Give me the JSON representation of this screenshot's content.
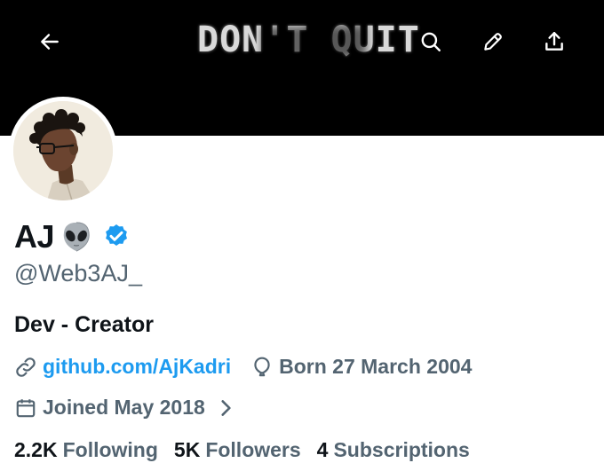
{
  "banner": {
    "text": "DON'T QUIT",
    "bg_color": "#000000"
  },
  "toolbar": {
    "back_icon": "arrow-left-icon",
    "search_icon": "search-icon",
    "edit_icon": "pencil-icon",
    "share_icon": "share-icon"
  },
  "profile": {
    "display_name": "AJ",
    "name_emoji": "alien-emoji",
    "verified_color": "#1d9bf0",
    "handle": "@Web3AJ_",
    "bio": "Dev - Creator",
    "website": "github.com/AjKadri",
    "birthday": "Born 27 March 2004",
    "joined": "Joined May 2018"
  },
  "stats": [
    {
      "count": "2.2K",
      "label": "Following"
    },
    {
      "count": "5K",
      "label": "Followers"
    },
    {
      "count": "4",
      "label": "Subscriptions"
    }
  ],
  "colors": {
    "accent": "#1d9bf0",
    "secondary_text": "#536471",
    "primary_text": "#0f1419"
  }
}
